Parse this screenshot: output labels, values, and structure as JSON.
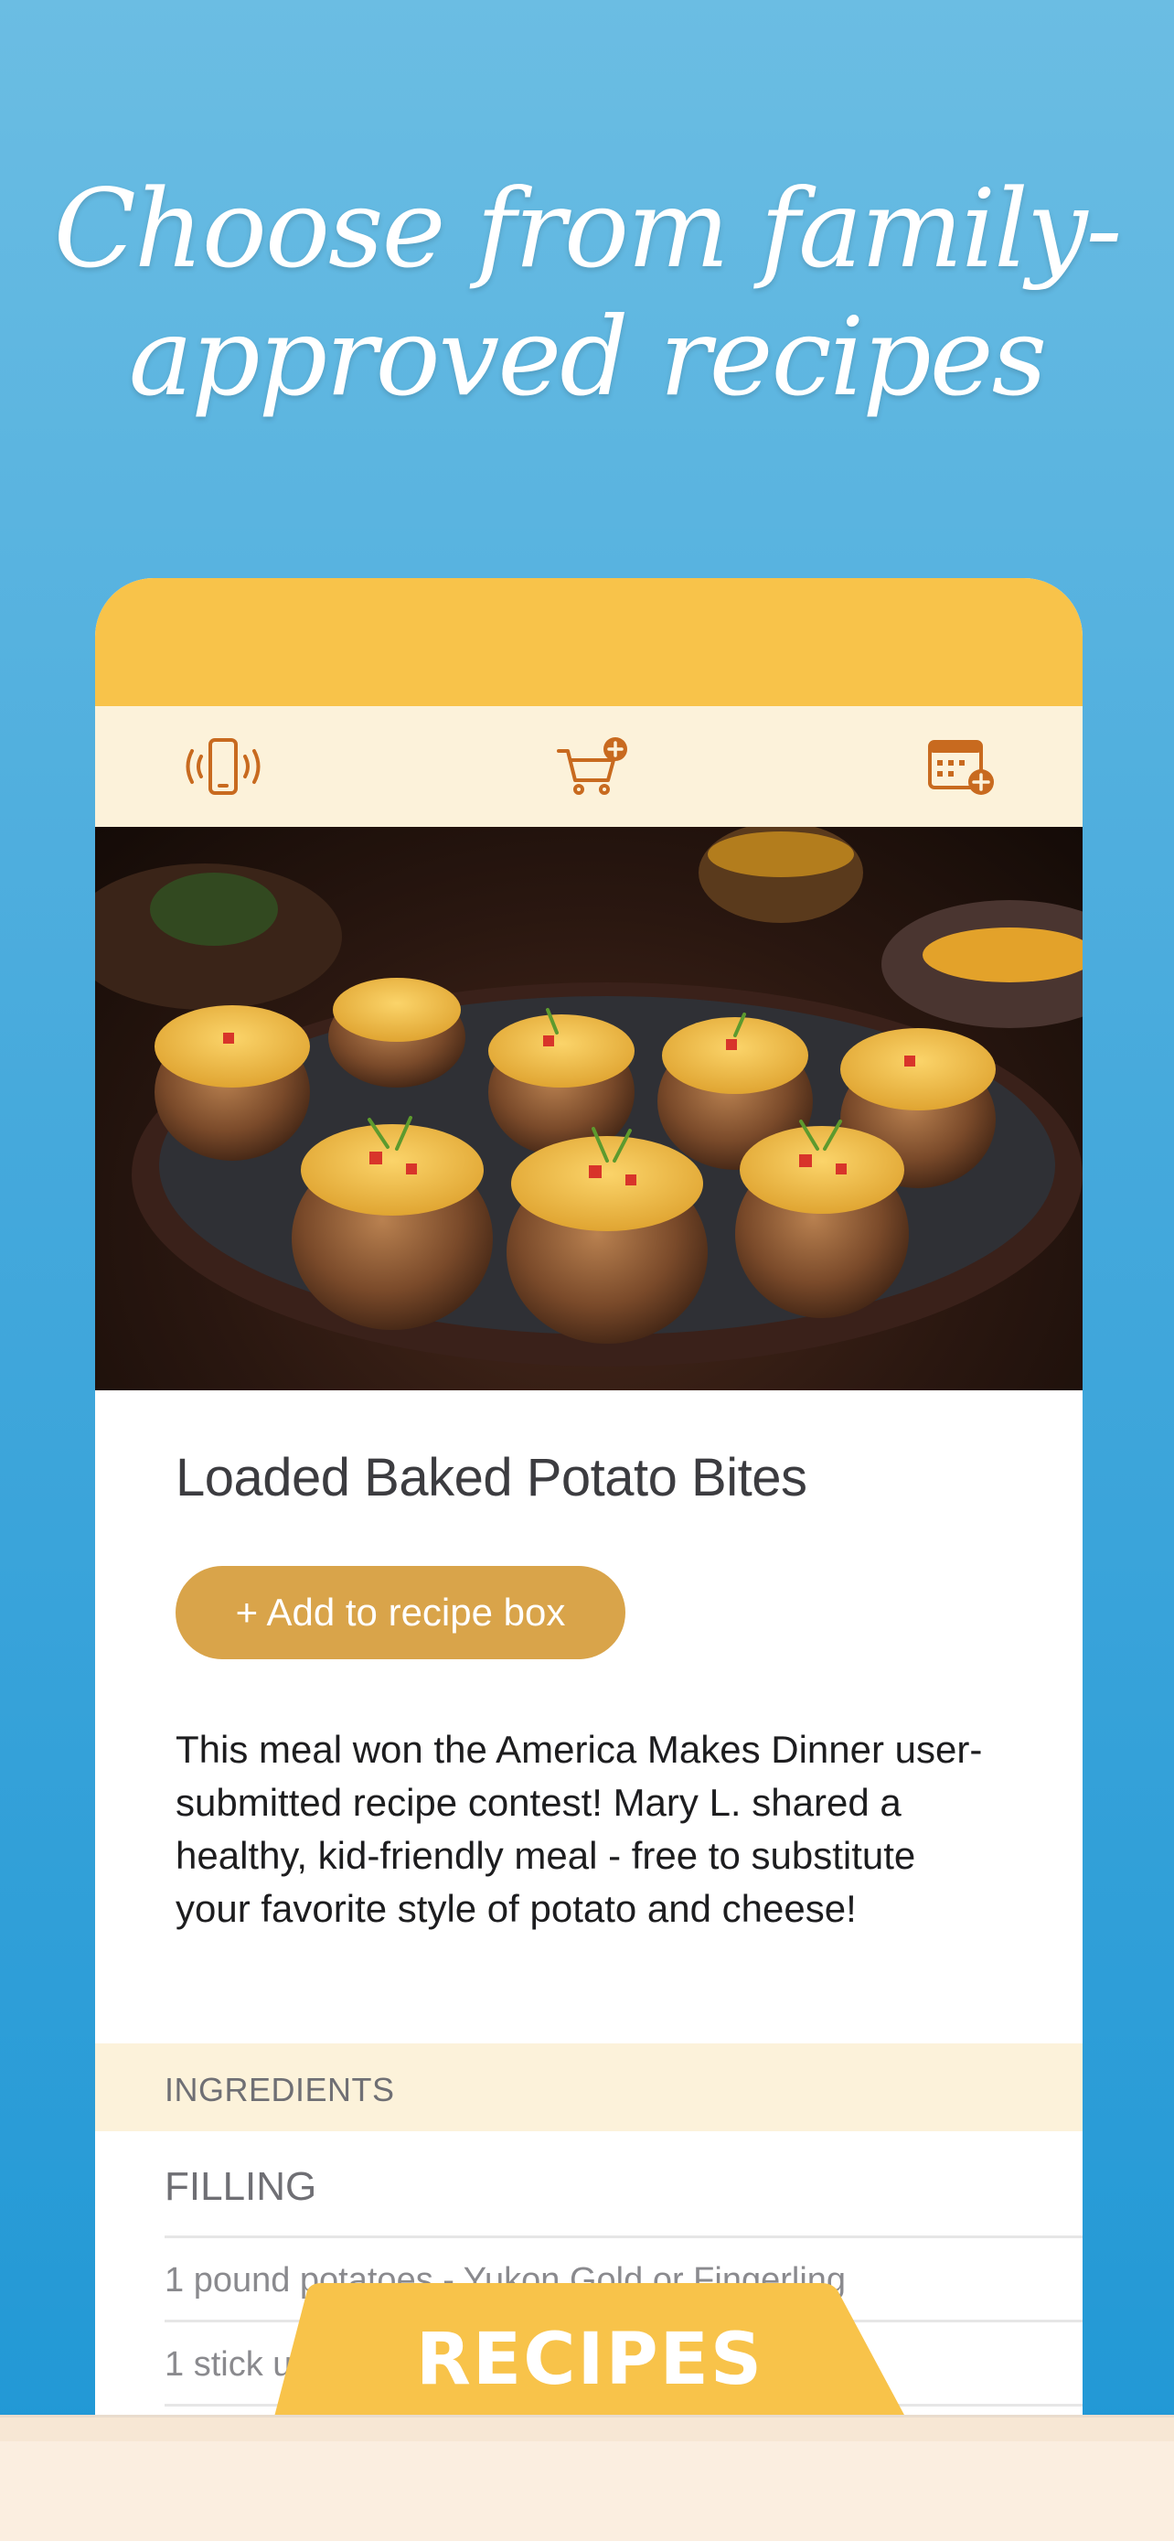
{
  "headline": {
    "line1": "Choose from family-",
    "line2": "approved recipes"
  },
  "toolbar": {
    "items": [
      {
        "icon": "phone-vibrate-icon",
        "label": "keep screen awake"
      },
      {
        "icon": "cart-add-icon",
        "label": "add to cart"
      },
      {
        "icon": "calendar-add-icon",
        "label": "add to calendar"
      }
    ]
  },
  "colors": {
    "accent_yellow": "#f8c34a",
    "accent_orange": "#c86a1f",
    "button_gold": "#d9a44a",
    "cream": "#fcf2da"
  },
  "recipe": {
    "title": "Loaded Baked Potato Bites",
    "add_button": "+ Add to recipe box",
    "description": "This meal won the America Makes Dinner user-submitted recipe contest! Mary L. shared a healthy, kid-friendly meal - free to substitute your favorite style of potato and cheese!"
  },
  "ingredients": {
    "header": "INGREDIENTS",
    "section": "FILLING",
    "items": [
      "1 pound potatoes - Yukon Gold or Fingerling",
      "1 stick unsalted butter"
    ]
  },
  "tab": {
    "label": "RECIPES"
  }
}
